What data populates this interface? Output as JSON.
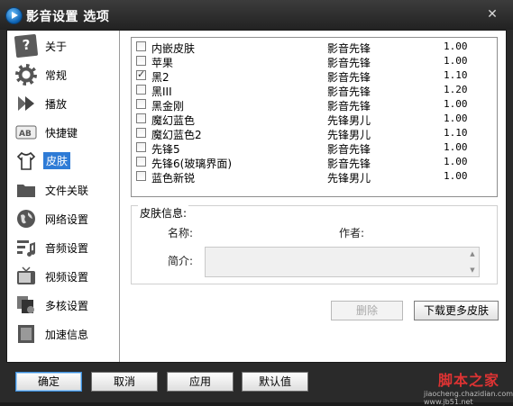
{
  "window": {
    "title": "影音设置 选项",
    "close_symbol": "✕"
  },
  "sidebar": {
    "items": [
      {
        "label": "关于",
        "icon": "about-icon"
      },
      {
        "label": "常规",
        "icon": "gear-icon"
      },
      {
        "label": "播放",
        "icon": "play-icon"
      },
      {
        "label": "快捷键",
        "icon": "keyboard-icon"
      },
      {
        "label": "皮肤",
        "icon": "shirt-icon",
        "active": true
      },
      {
        "label": "文件关联",
        "icon": "folder-icon"
      },
      {
        "label": "网络设置",
        "icon": "globe-icon"
      },
      {
        "label": "音频设置",
        "icon": "equalizer-icon"
      },
      {
        "label": "视频设置",
        "icon": "tv-icon"
      },
      {
        "label": "多核设置",
        "icon": "multicore-icon"
      },
      {
        "label": "加速信息",
        "icon": "speed-icon"
      }
    ]
  },
  "skins": [
    {
      "name": "内嵌皮肤",
      "author": "影音先锋",
      "version": "1.00",
      "checked": false
    },
    {
      "name": "苹果",
      "author": "影音先锋",
      "version": "1.00",
      "checked": false
    },
    {
      "name": "黑2",
      "author": "影音先锋",
      "version": "1.10",
      "checked": true
    },
    {
      "name": "黑III",
      "author": "影音先锋",
      "version": "1.20",
      "checked": false
    },
    {
      "name": "黑金刚",
      "author": "影音先锋",
      "version": "1.00",
      "checked": false
    },
    {
      "name": "魔幻蓝色",
      "author": "先锋男儿",
      "version": "1.00",
      "checked": false
    },
    {
      "name": "魔幻蓝色2",
      "author": "先锋男儿",
      "version": "1.10",
      "checked": false
    },
    {
      "name": "先锋5",
      "author": "影音先锋",
      "version": "1.00",
      "checked": false
    },
    {
      "name": "先锋6(玻璃界面)",
      "author": "影音先锋",
      "version": "1.00",
      "checked": false
    },
    {
      "name": "蓝色新锐",
      "author": "先锋男儿",
      "version": "1.00",
      "checked": false
    }
  ],
  "skin_info": {
    "legend": "皮肤信息:",
    "name_label": "名称:",
    "author_label": "作者:",
    "intro_label": "简介:"
  },
  "actions": {
    "delete_label": "删除",
    "download_label": "下载更多皮肤"
  },
  "footer": {
    "ok": "确定",
    "cancel": "取消",
    "apply": "应用",
    "default": "默认值"
  },
  "watermark": {
    "text": "脚本之家",
    "sub": "jiaocheng.chazidian.com  www.jb51.net"
  },
  "colors": {
    "title_bar": "#2a2a2a",
    "selection": "#2e7bd6"
  }
}
